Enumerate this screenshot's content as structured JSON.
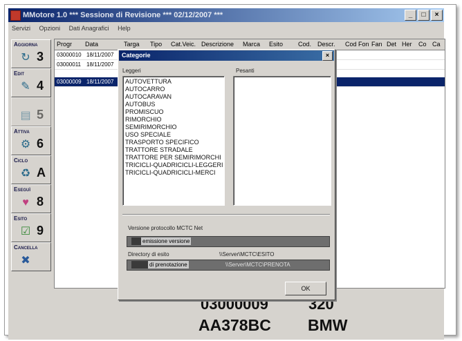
{
  "window": {
    "title": "MMotore 1.0 *** Sessione di Revisione *** 02/12/2007 ***",
    "min": "_",
    "max": "□",
    "close": "×"
  },
  "menu": [
    "Servizi",
    "Opzioni",
    "Dati Anagrafici",
    "Help"
  ],
  "toolbar": {
    "buttons": [
      {
        "label": "Aggiorna",
        "key": "3"
      },
      {
        "label": "Edit",
        "key": "4"
      },
      {
        "label": "",
        "key": "5"
      },
      {
        "label": "Attiva",
        "key": "6"
      },
      {
        "label": "Ciclo",
        "key": "A"
      },
      {
        "label": "Eseguì",
        "key": "8"
      },
      {
        "label": "Esito",
        "key": "9"
      },
      {
        "label": "Cancella",
        "key": ""
      }
    ]
  },
  "grid": {
    "headers": [
      "Progr",
      "Data",
      "Targa",
      "Tipo",
      "Cat.Veic.",
      "Descrizione",
      "Marca",
      "Esito",
      "Cod.",
      "Descr.",
      "Cod Fon",
      "Fan",
      "Det",
      "Her",
      "Co",
      "Ca"
    ],
    "rows": [
      {
        "progr": "03000010",
        "date": "18/11/2007"
      },
      {
        "progr": "03000011",
        "date": "18/11/2007"
      },
      {
        "progr": "03000009",
        "date": "18/11/2007"
      }
    ]
  },
  "dialog": {
    "title": "Categorie",
    "close": "×",
    "legger_label": "Leggeri",
    "pesanti_label": "Pesanti",
    "legger_items": [
      "AUTOVETTURA",
      "AUTOCARRO",
      "AUTOCARAVAN",
      "AUTOBUS",
      "PROMISCUO",
      "RIMORCHIO",
      "SEMIRIMORCHIO",
      "USO SPECIALE",
      "TRASPORTO SPECIFICO",
      "TRATTORE STRADALE",
      "TRATTORE PER SEMIRIMORCHI",
      "TRICICLI-QUADRICICLI-LEGGERI",
      "TRICICLI-QUADRICICLI-MERCI"
    ],
    "protocol_label": "Versione protocollo MCTC Net",
    "emission_label": "emissione versione",
    "dir_esito_label": "Directory di esito",
    "dir_esito_value": "\\\\Server\\MCTC\\ESITO",
    "dir_pren_label": "di prenotazione",
    "dir_pren_value": "\\\\Server\\MCTC\\PRENOTA",
    "ok_label": "OK"
  },
  "bottom": {
    "number": "03000009",
    "value": "320",
    "plate": "AA378BC",
    "brand": "BMW"
  }
}
